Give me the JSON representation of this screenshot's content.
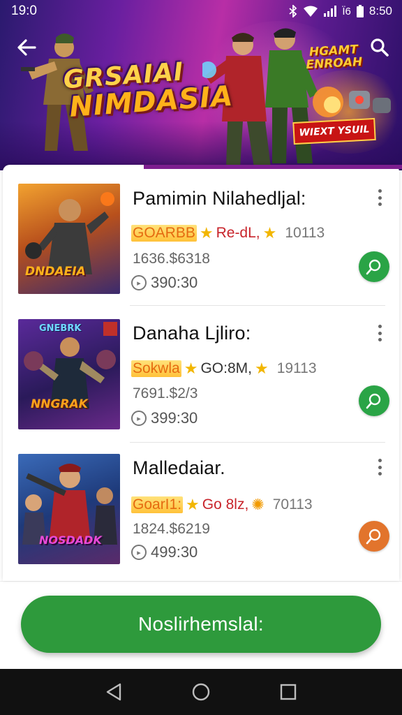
{
  "status_bar": {
    "time_left": "19:0",
    "network": "Ï6",
    "time_right": "8:50",
    "icons": [
      "bluetooth-icon",
      "wifi-icon",
      "signal-icon",
      "battery-icon"
    ]
  },
  "header": {
    "back_icon": "arrow-left-icon",
    "search_icon": "search-icon"
  },
  "hero": {
    "logo_line1": "GRSAIAI",
    "logo_line2": "NIMDASIA",
    "badge_line1": "HGAMT",
    "badge_line2": "ENROAH",
    "cta": "WIEXT YSUIL"
  },
  "games": [
    {
      "title": "Pamimin Nilahedljal:",
      "tag": "GOARBB",
      "genre": "Re-dL,",
      "count": "10113",
      "size": "1636.$6318",
      "duration": "390:30",
      "thumb_text": "DNDAEIA",
      "play_color": "#2aa446"
    },
    {
      "title": "Danaha Ljliro:",
      "tag": "Sokwla",
      "genre": "GO:8M,",
      "count": "19113",
      "size": "7691.$2/3",
      "duration": "399:30",
      "thumb_text": "NNGRAK",
      "play_color": "#2aa446"
    },
    {
      "title": "Malledaiar.",
      "tag": "GoarI1:",
      "genre": "Go 8lz,",
      "count": "70113",
      "size": "1824.$6219",
      "duration": "499:30",
      "thumb_text": "NOSDADK",
      "play_color": "#e2742c"
    }
  ],
  "primary_button": "Noslirhemslal:",
  "nav": {
    "back": "triangle-back-icon",
    "home": "circle-home-icon",
    "recents": "square-recents-icon"
  },
  "colors": {
    "accent_green": "#2e9a3c",
    "hero_purple": "#7d1f8f",
    "tag_orange": "#e56a10",
    "genre_red": "#c8242b"
  }
}
